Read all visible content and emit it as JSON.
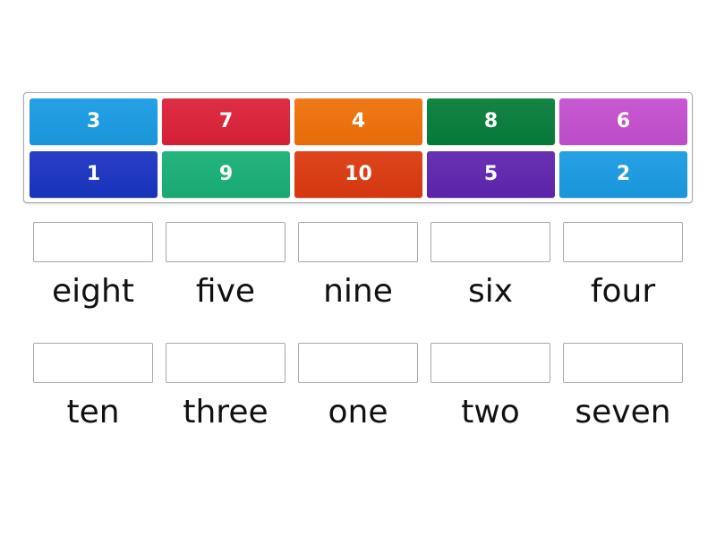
{
  "tiles": [
    {
      "label": "3",
      "color": "#1a9be3"
    },
    {
      "label": "7",
      "color": "#dc2139"
    },
    {
      "label": "4",
      "color": "#f0700a"
    },
    {
      "label": "8",
      "color": "#067d39"
    },
    {
      "label": "6",
      "color": "#c44fcf"
    },
    {
      "label": "1",
      "color": "#1a34c2"
    },
    {
      "label": "9",
      "color": "#18b076"
    },
    {
      "label": "10",
      "color": "#dc3a10"
    },
    {
      "label": "5",
      "color": "#5f25b0"
    },
    {
      "label": "2",
      "color": "#1a9be3"
    }
  ],
  "targets": [
    {
      "word": "eight"
    },
    {
      "word": "five"
    },
    {
      "word": "nine"
    },
    {
      "word": "six"
    },
    {
      "word": "four"
    },
    {
      "word": "ten"
    },
    {
      "word": "three"
    },
    {
      "word": "one"
    },
    {
      "word": "two"
    },
    {
      "word": "seven"
    }
  ]
}
